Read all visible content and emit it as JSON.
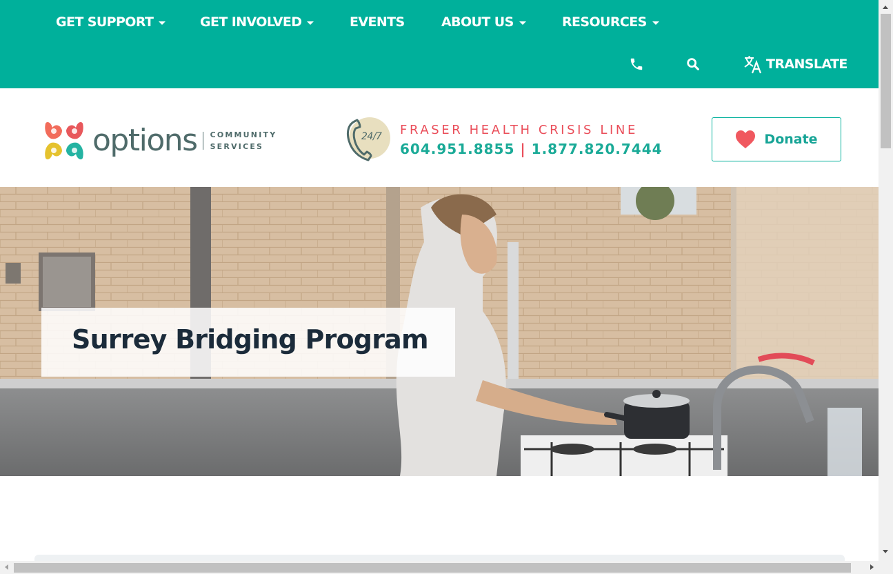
{
  "nav": {
    "items": [
      {
        "label": "GET SUPPORT",
        "dropdown": true
      },
      {
        "label": "GET INVOLVED",
        "dropdown": true
      },
      {
        "label": "EVENTS",
        "dropdown": false
      },
      {
        "label": "ABOUT US",
        "dropdown": true
      },
      {
        "label": "RESOURCES",
        "dropdown": true
      }
    ],
    "utility": {
      "phone_icon": "phone-icon",
      "search_icon": "search-icon",
      "translate_icon": "translate-icon",
      "translate_label": "TRANSLATE"
    }
  },
  "header": {
    "logo": {
      "word": "options",
      "sub_line1": "COMMUNITY",
      "sub_line2": "SERVICES"
    },
    "crisis": {
      "badge": "24/7",
      "title": "FRASER HEALTH CRISIS LINE",
      "phone1": "604.951.8855",
      "separator": "|",
      "phone2": "1.877.820.7444"
    },
    "donate": {
      "label": "Donate",
      "icon": "heart-icon"
    }
  },
  "hero": {
    "title": "Surrey Bridging Program"
  },
  "colors": {
    "brand_teal": "#00b09b",
    "crisis_red": "#ea4e5a",
    "logo_slate": "#4f6b6a",
    "heart": "#f0585f"
  }
}
